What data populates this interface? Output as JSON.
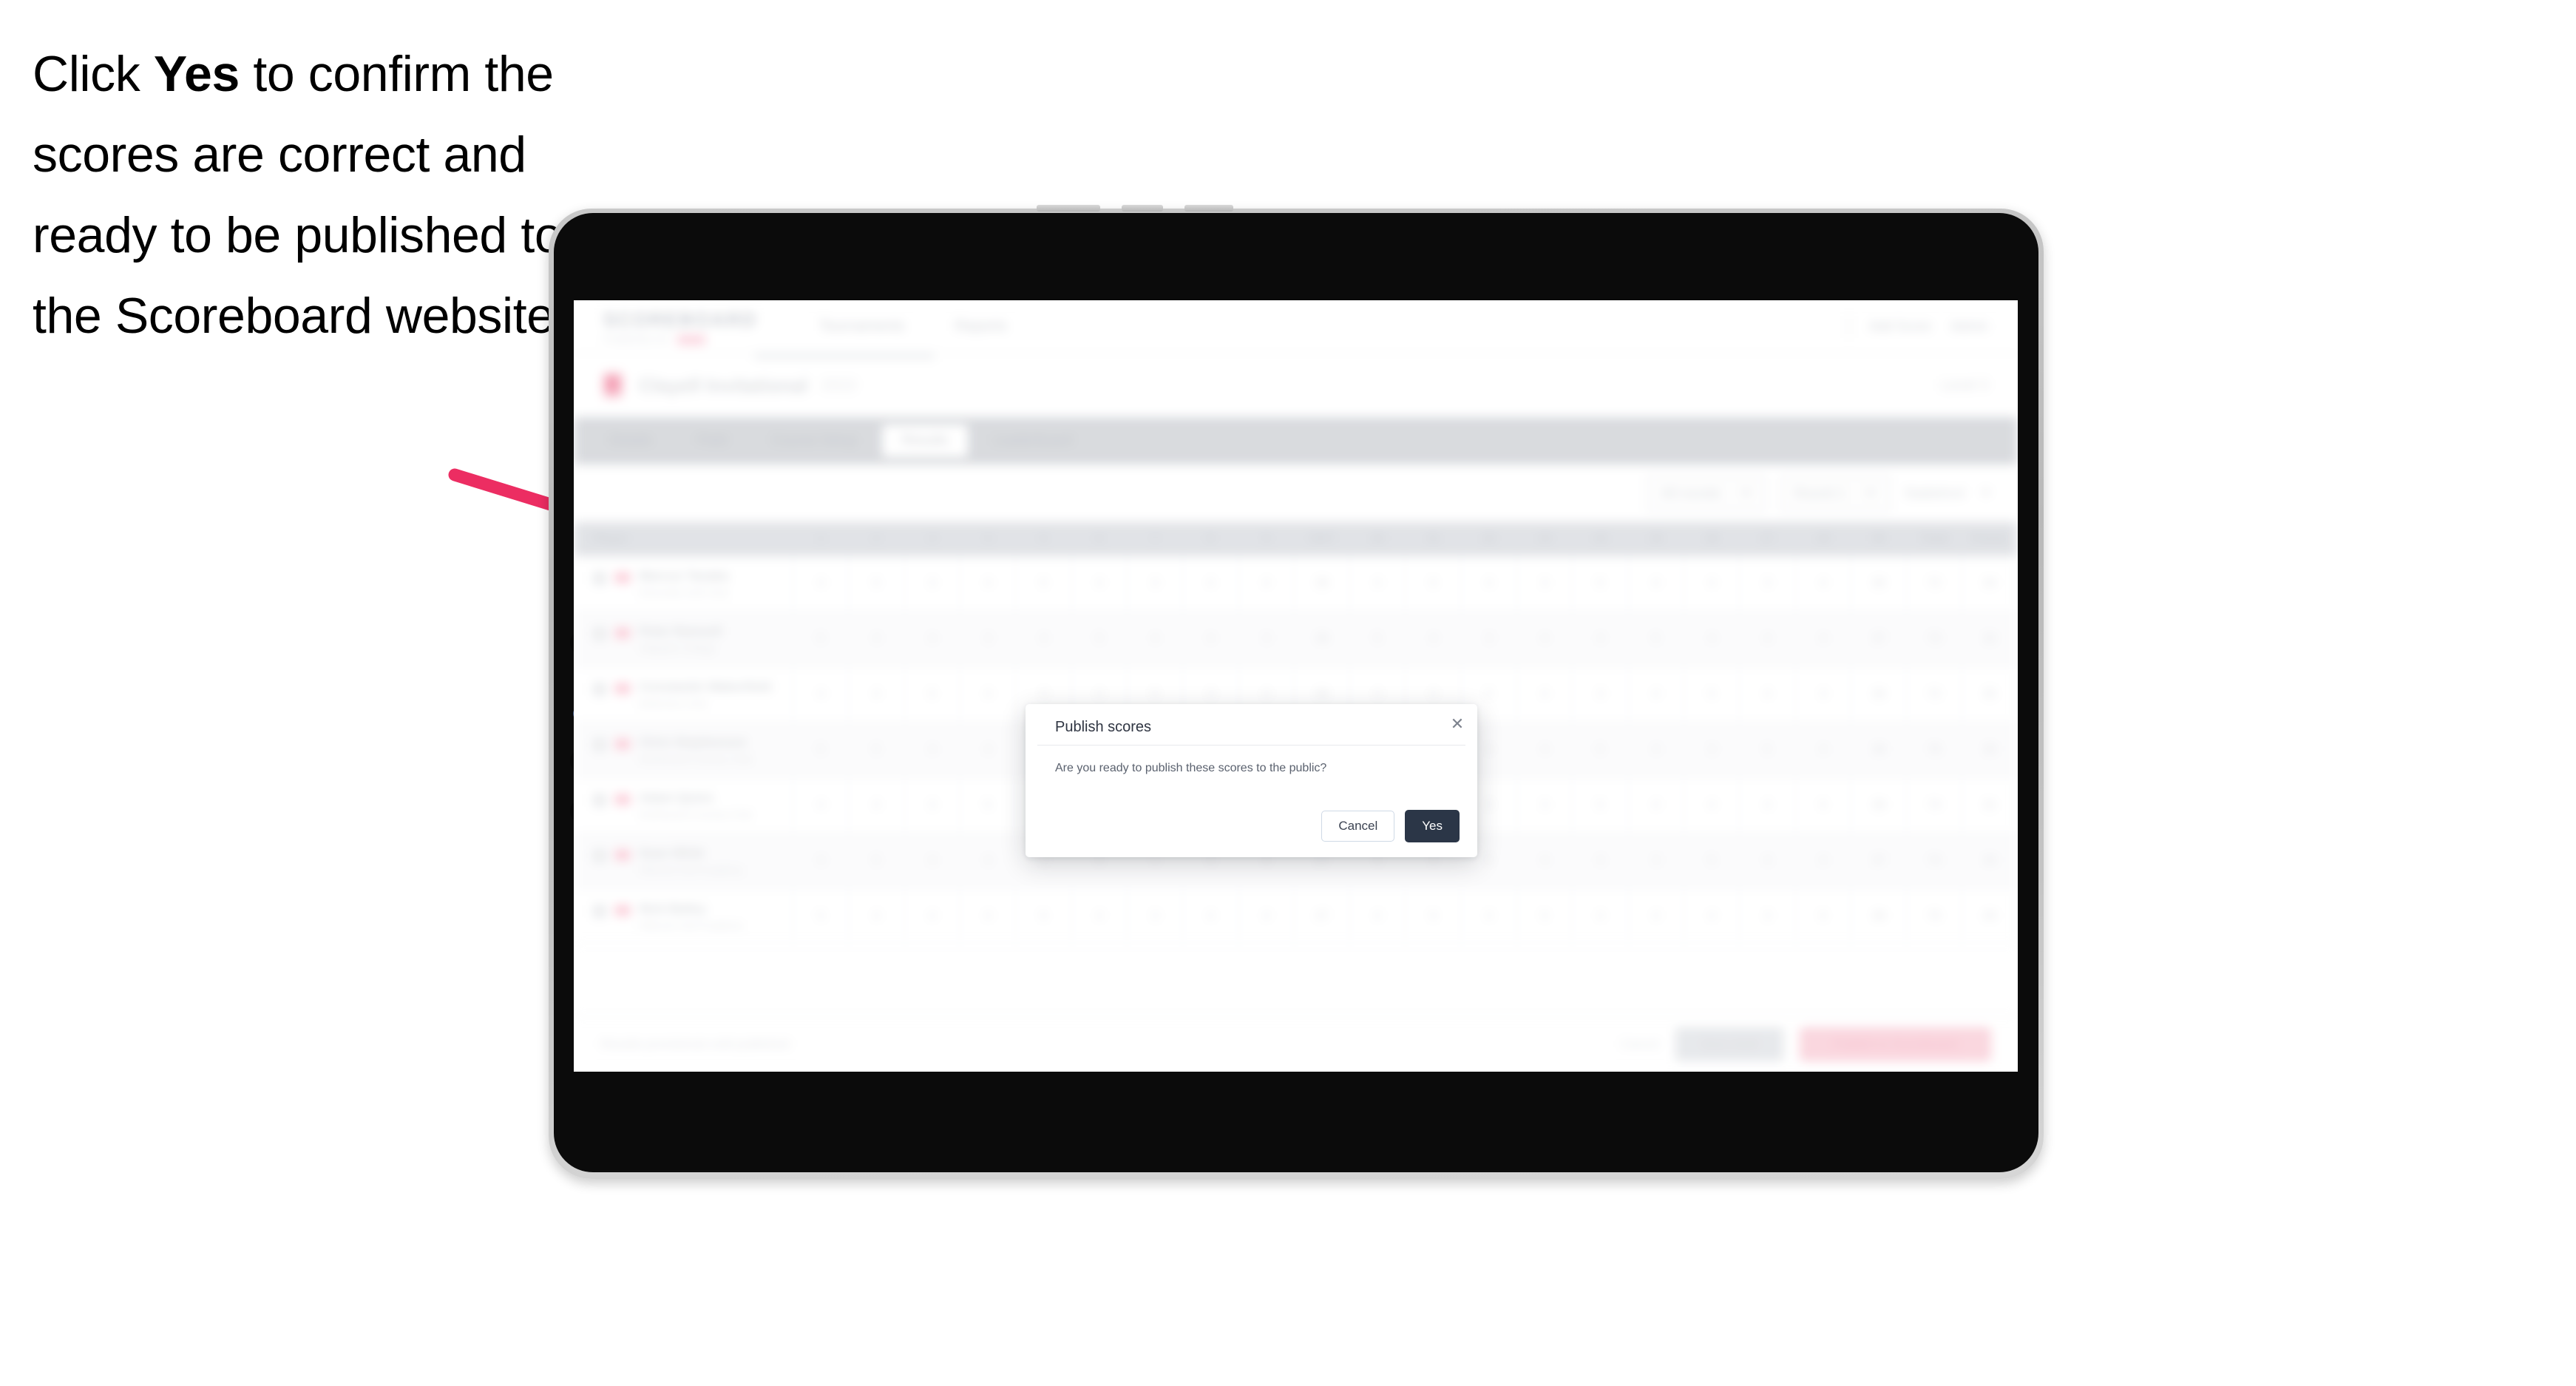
{
  "caption": {
    "lead": "Click ",
    "emphasis": "Yes",
    "rest": " to confirm the scores are correct and ready to be published to the Scoreboard website."
  },
  "annotation": {
    "arrow_color": "#ec2d62",
    "arrow_name": "instruction-arrow"
  },
  "device": {
    "type": "tablet",
    "frame_color": "#c2c2c2",
    "body_color": "#0b0b0b"
  },
  "app": {
    "brand": {
      "name": "SCOREBOARD",
      "sub": "POWERED BY",
      "badge": ""
    },
    "topnav": [
      {
        "label": "Tournaments"
      },
      {
        "label": "Reports"
      }
    ],
    "topbar_right": [
      {
        "label": "Add Score"
      },
      {
        "label": "Admin"
      }
    ],
    "tournament": {
      "title": "Clayell Invitational",
      "subtitle": "2022",
      "right_meta": "Level 3"
    },
    "tabs": [
      {
        "label": "Details",
        "active": false
      },
      {
        "label": "Field",
        "active": false
      },
      {
        "label": "Course Setup",
        "active": false
      },
      {
        "label": "Results",
        "active": true
      },
      {
        "label": "Leaderboard",
        "active": false
      }
    ],
    "toolbar": {
      "filters": [
        {
          "label": "All rounds"
        },
        {
          "label": "Round 1"
        },
        {
          "label": "Stableford"
        }
      ]
    },
    "table": {
      "columns": [
        "Player",
        "1",
        "2",
        "3",
        "4",
        "5",
        "6",
        "7",
        "8",
        "9",
        "OUT",
        "10",
        "11",
        "12",
        "13",
        "14",
        "15",
        "16",
        "17",
        "18",
        "IN",
        "Total",
        "Points"
      ],
      "rows": [
        {
          "name": "Marcus Tanaka",
          "club": "Riverside Golf Club",
          "scores": [
            "4",
            "5",
            "3",
            "4",
            "5",
            "4",
            "3",
            "4",
            "4",
            "36",
            "4",
            "5",
            "4",
            "3",
            "5",
            "4",
            "4",
            "3",
            "4",
            "36",
            "72",
            "34"
          ]
        },
        {
          "name": "Peter Ramsell",
          "club": "Oakpark College",
          "scores": [
            "5",
            "4",
            "4",
            "3",
            "4",
            "5",
            "4",
            "4",
            "3",
            "36",
            "5",
            "4",
            "3",
            "4",
            "4",
            "5",
            "4",
            "4",
            "4",
            "37",
            "73",
            "32"
          ]
        },
        {
          "name": "Constantin Wakerfield",
          "club": "Belleview Club",
          "scores": [
            "4",
            "4",
            "5",
            "4",
            "3",
            "4",
            "5",
            "3",
            "4",
            "36",
            "4",
            "4",
            "5",
            "4",
            "3",
            "4",
            "5",
            "4",
            "3",
            "36",
            "72",
            "35"
          ]
        },
        {
          "name": "Chris Stephenson",
          "club": "Northwood Country Club",
          "scores": [
            "5",
            "5",
            "4",
            "4",
            "4",
            "3",
            "5",
            "4",
            "4",
            "38",
            "4",
            "5",
            "4",
            "4",
            "5",
            "4",
            "3",
            "5",
            "4",
            "38",
            "76",
            "30"
          ]
        },
        {
          "name": "Adam Quinn",
          "club": "Northwood Country Club",
          "scores": [
            "4",
            "4",
            "3",
            "5",
            "4",
            "4",
            "4",
            "5",
            "3",
            "36",
            "5",
            "4",
            "4",
            "3",
            "5",
            "4",
            "4",
            "4",
            "5",
            "38",
            "74",
            "31"
          ]
        },
        {
          "name": "Sean Whitt",
          "club": "Hillcrest Golf Academy",
          "scores": [
            "4",
            "5",
            "4",
            "4",
            "3",
            "5",
            "4",
            "4",
            "4",
            "37",
            "4",
            "4",
            "5",
            "4",
            "4",
            "3",
            "5",
            "4",
            "4",
            "37",
            "74",
            "33"
          ]
        },
        {
          "name": "Nick Bailey",
          "club": "Hillcrest Golf Academy",
          "scores": [
            "5",
            "4",
            "4",
            "4",
            "5",
            "4",
            "3",
            "4",
            "4",
            "37",
            "4",
            "5",
            "4",
            "5",
            "4",
            "4",
            "4",
            "3",
            "5",
            "38",
            "75",
            "29"
          ]
        }
      ]
    },
    "footer": {
      "note": "Results provisional until published",
      "link": "Cancel",
      "secondary_button": "Save draft",
      "primary_button": "Publish to Scoreboard"
    }
  },
  "modal": {
    "title": "Publish scores",
    "body": "Are you ready to publish these scores to the public?",
    "cancel_label": "Cancel",
    "confirm_label": "Yes",
    "close_icon": "✕",
    "confirm_color": "#2b3647"
  }
}
